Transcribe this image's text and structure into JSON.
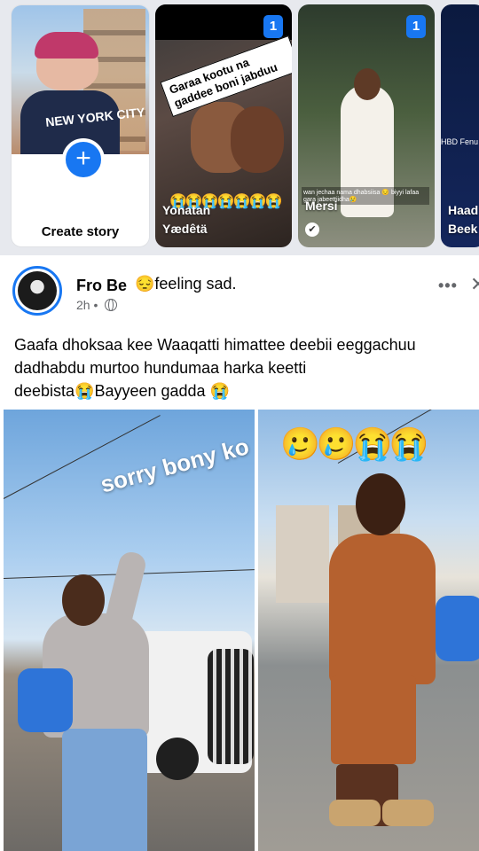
{
  "stories": {
    "create_label": "Create story",
    "create_photo_text": "NEW YORK CITY",
    "items": [
      {
        "badge": "1",
        "name_line1": "Yonatan",
        "name_line2": "Yædêtä",
        "sticker": "Garaa kootu na gaddee boni jabduu",
        "emoji_row": "😭😭😭😭😭😭😭"
      },
      {
        "badge": "1",
        "name_line1": "Mersi",
        "caption": "wan jechaa nama dhabsiisa 😔 biyyi lafaa gara jabeettiidha😢"
      },
      {
        "name_line1": "Haad",
        "name_line2": "Beek",
        "hbd": "HBD Fenu"
      }
    ]
  },
  "post": {
    "author": "Fro Be",
    "feeling_emoji": "😔",
    "feeling": "feeling sad.",
    "time": "2h",
    "more": "•••",
    "close": "✕",
    "text_line1": "Gaafa dhoksaa kee Waaqatti himattee deebii eeggachuu",
    "text_line2": "dadhabdu murtoo hundumaa harka keetti",
    "text_line3": "deebista😭Bayyeen gadda 😭",
    "photo_caption": "sorry bony ko",
    "photo_emojis": "🥲🥲😭😭"
  },
  "colors": {
    "accent": "#1877f2",
    "story_bg": "#e7e9ee",
    "meta": "#65676b"
  },
  "icons": [
    "plus-icon",
    "globe-icon",
    "more-icon",
    "close-icon",
    "verified-icon"
  ]
}
